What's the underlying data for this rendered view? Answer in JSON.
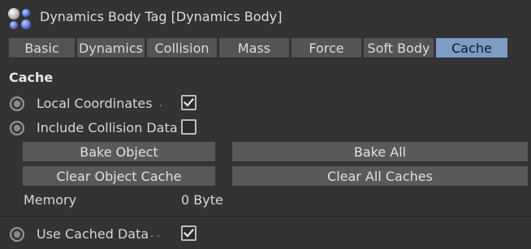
{
  "header": {
    "title": "Dynamics Body Tag [Dynamics Body]",
    "icon": "dynamics-body-tag-icon"
  },
  "tabs": [
    {
      "label": "Basic",
      "active": false
    },
    {
      "label": "Dynamics",
      "active": false
    },
    {
      "label": "Collision",
      "active": false
    },
    {
      "label": "Mass",
      "active": false
    },
    {
      "label": "Force",
      "active": false
    },
    {
      "label": "Soft Body",
      "active": false
    },
    {
      "label": "Cache",
      "active": true
    }
  ],
  "section": {
    "title": "Cache"
  },
  "params": {
    "local_coordinates": {
      "label": "Local Coordinates",
      "dots": ".",
      "checked": true
    },
    "include_collision": {
      "label": "Include Collision Data",
      "dots": "",
      "checked": false
    },
    "use_cached_data": {
      "label": "Use Cached Data",
      "dots": ". .",
      "checked": true
    }
  },
  "buttons": {
    "bake_object": "Bake Object",
    "bake_all": "Bake All",
    "clear_object_cache": "Clear Object Cache",
    "clear_all_caches": "Clear All Caches"
  },
  "memory": {
    "label": "Memory",
    "value": "0 Byte"
  },
  "colors": {
    "background": "#333333",
    "tab": "#545454",
    "tab_active": "#7e9bc6",
    "button": "#595959",
    "text": "#d6d6d6"
  }
}
